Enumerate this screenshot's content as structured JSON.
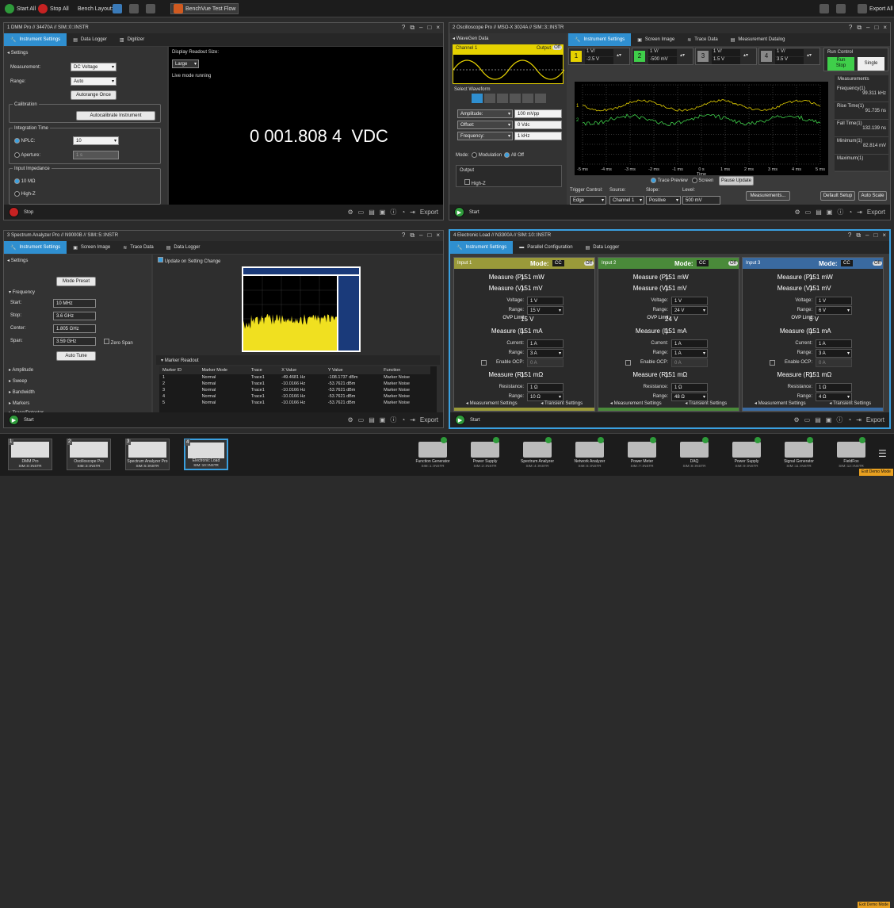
{
  "toolbar": {
    "start_all": "Start All",
    "stop_all": "Stop All",
    "bench_layout": "Bench Layout:",
    "test_flow": "BenchVue Test Flow",
    "export_all": "Export All"
  },
  "dmm": {
    "title": "1 DMM Pro // 34470A // SIM::0::INSTR",
    "tabs": [
      "Instrument Settings",
      "Data Logger",
      "Digitizer"
    ],
    "settings_header": "Settings",
    "measurement_label": "Measurement:",
    "measurement_value": "DC Voltage",
    "range_label": "Range:",
    "range_value": "Auto",
    "autorange_btn": "Autorange Once",
    "calibration_label": "Calibration",
    "autocal_btn": "Autocalibrate Instrument",
    "integration_label": "Integration Time",
    "nplc_label": "NPLC:",
    "nplc_value": "10",
    "aperture_label": "Aperture:",
    "aperture_value": "1 s",
    "impedance_label": "Input Impedance",
    "imp_10m": "10 MΩ",
    "imp_highz": "High-Z",
    "display_size_label": "Display Readout Size:",
    "display_size_value": "Large",
    "live_mode": "Live mode running",
    "readout": "0 001.808 4  VDC",
    "stop": "Stop",
    "export": "Export"
  },
  "scope": {
    "title": "2 Oscilloscope Pro // MSO-X 3024A // SIM::3::INSTR",
    "wavegen_header": "WaveGen Data",
    "tabs": [
      "Instrument Settings",
      "Screen Image",
      "Trace Data",
      "Measurement Datalog"
    ],
    "channel1": "Channel 1",
    "output": "Output",
    "off": "Off",
    "select_waveform": "Select Waveform",
    "amplitude_label": "Amplitude:",
    "amplitude_value": "100 mVpp",
    "offset_label": "Offset:",
    "offset_value": "0 Vdc",
    "frequency_label": "Frequency:",
    "frequency_value": "1 kHz",
    "mode_label": "Mode:",
    "modulation": "Modulation",
    "all_off": "All Off",
    "output_label": "Output",
    "highz": "High-Z",
    "ch": [
      {
        "num": "1",
        "scale": "1 V/",
        "offset": "-2.5 V",
        "color": "#e6d200"
      },
      {
        "num": "2",
        "scale": "1 V/",
        "offset": "-500 mV",
        "color": "#3fcf4a"
      },
      {
        "num": "3",
        "scale": "1 V/",
        "offset": "1.5 V",
        "color": "#888888"
      },
      {
        "num": "4",
        "scale": "1 V/",
        "offset": "3.5 V",
        "color": "#888888"
      }
    ],
    "run_control": "Run Control",
    "run_stop": "Run\nStop",
    "single": "Single",
    "measurements_header": "Measurements",
    "measurements": [
      {
        "name": "Frequency(1)",
        "value": "99.311 kHz"
      },
      {
        "name": "Rise Time(1)",
        "value": "91.735 ns"
      },
      {
        "name": "Fall Time(1)",
        "value": "132.139 ns"
      },
      {
        "name": "Minimum(1)",
        "value": "82.814 mV"
      },
      {
        "name": "Maximum(1)",
        "value": ""
      }
    ],
    "x_ticks": [
      "-5 ms",
      "-4 ms",
      "-3 ms",
      "-2 ms",
      "-1 ms",
      "0 s",
      "1 ms",
      "2 ms",
      "3 ms",
      "4 ms",
      "5 ms"
    ],
    "time_label": "Time",
    "trace_preview": "Trace Preview",
    "screen": "Screen",
    "pause_update": "Pause Update",
    "trigger_control_label": "Trigger Control:",
    "trigger_control_value": "Edge",
    "source_label": "Source:",
    "source_value": "Channel 1",
    "slope_label": "Slope:",
    "slope_value": "Positive",
    "level_label": "Level:",
    "level_value": "500 mV",
    "measurements_btn": "Measurements...",
    "default_setup": "Default Setup",
    "auto_scale": "Auto Scale",
    "start": "Start",
    "export": "Export"
  },
  "spec": {
    "title": "3 Spectrum Analyzer Pro // N9000B // SIM::5::INSTR",
    "tabs": [
      "Instrument Settings",
      "Screen Image",
      "Trace Data",
      "Data Logger"
    ],
    "settings_header": "Settings",
    "update_label": "Update on Setting Change",
    "frequency_header": "Frequency",
    "mode_preset": "Mode Preset",
    "start_label": "Start:",
    "start_value": "10 MHz",
    "stop_label": "Stop:",
    "stop_value": "3.6 GHz",
    "center_label": "Center:",
    "center_value": "1.805 GHz",
    "span_label": "Span:",
    "span_value": "3.59 GHz",
    "zero_span": "Zero Span",
    "auto_tune": "Auto Tune",
    "sections": [
      "Amplitude",
      "Sweep",
      "Bandwidth",
      "Markers",
      "Trace/Detector"
    ],
    "marker_readout": "Marker Readout",
    "marker_cols": [
      "Marker ID",
      "Marker Mode",
      "Trace",
      "X Value",
      "Y Value",
      "Function"
    ],
    "markers": [
      [
        "1",
        "Normal",
        "Trace1",
        "-49.4681 Hz",
        "-108.1737 dBm",
        "Marker Noise"
      ],
      [
        "2",
        "Normal",
        "Trace1",
        "-10.0166 Hz",
        "-53.7621 dBm",
        "Marker Noise"
      ],
      [
        "3",
        "Normal",
        "Trace1",
        "-10.0166 Hz",
        "-53.7621 dBm",
        "Marker Noise"
      ],
      [
        "4",
        "Normal",
        "Trace1",
        "-10.0166 Hz",
        "-53.7621 dBm",
        "Marker Noise"
      ],
      [
        "5",
        "Normal",
        "Trace1",
        "-10.0166 Hz",
        "-53.7621 dBm",
        "Marker Noise"
      ]
    ],
    "start": "Start",
    "export": "Export"
  },
  "load": {
    "title": "4 Electronic Load // N3300A // SIM::10::INSTR",
    "tabs": [
      "Instrument Settings",
      "Parallel Configuration",
      "Data Logger"
    ],
    "inputs": [
      {
        "name": "Input 1",
        "mode_label": "Mode:",
        "mode": "CC",
        "off": "Off",
        "color": "#9a9a3a",
        "power": "151 mW",
        "voltage": "151 mV",
        "voltage_set": "1 V",
        "v_range": "15 V",
        "ovp": "15 V",
        "current": "151 mA",
        "current_set": "1 A",
        "i_range": "3 A",
        "ocp": "0 A",
        "resistance": "151 mΩ",
        "res_set": "1 Ω",
        "r_range": "10 Ω"
      },
      {
        "name": "Input 2",
        "mode_label": "Mode:",
        "mode": "CC",
        "off": "Off",
        "color": "#4a8a3a",
        "power": "151 mW",
        "voltage": "151 mV",
        "voltage_set": "1 V",
        "v_range": "24 V",
        "ovp": "24 V",
        "current": "151 mA",
        "current_set": "1 A",
        "i_range": "1 A",
        "ocp": "0 A",
        "resistance": "151 mΩ",
        "res_set": "1 Ω",
        "r_range": "48 Ω"
      },
      {
        "name": "Input 3",
        "mode_label": "Mode:",
        "mode": "CC",
        "off": "Off",
        "color": "#3a6aa0",
        "power": "151 mW",
        "voltage": "151 mV",
        "voltage_set": "1 V",
        "v_range": "6 V",
        "ovp": "6 V",
        "current": "151 mA",
        "current_set": "1 A",
        "i_range": "3 A",
        "ocp": "0 A",
        "resistance": "151 mΩ",
        "res_set": "1 Ω",
        "r_range": "4 Ω"
      }
    ],
    "labels": {
      "power": "Measure (P):",
      "voltage": "Measure (V):",
      "voltage_set": "Voltage:",
      "range": "Range:",
      "ovp": "OVP Limit:",
      "current": "Measure (I):",
      "current_set": "Current:",
      "enable_ocp": "Enable OCP:",
      "resistance": "Measure (R):",
      "res_set": "Resistance:",
      "meas_settings": "Measurement Settings",
      "trans_settings": "Transient Settings"
    },
    "start": "Start",
    "export": "Export"
  },
  "dock": {
    "thumbs": [
      {
        "num": "1",
        "name": "DMM Pro",
        "addr": "SIM::0::INSTR"
      },
      {
        "num": "2",
        "name": "Oscilloscope Pro",
        "addr": "SIM::3::INSTR"
      },
      {
        "num": "3",
        "name": "Spectrum Analyzer Pro",
        "addr": "SIM::5::INSTR"
      },
      {
        "num": "4",
        "name": "Electronic Load",
        "addr": "SIM::10::INSTR"
      }
    ],
    "instruments": [
      {
        "name": "Function Generator",
        "addr": "SIM::1::INSTR"
      },
      {
        "name": "Power Supply",
        "addr": "SIM::2::INSTR"
      },
      {
        "name": "Spectrum Analyzer",
        "addr": "SIM::4::INSTR"
      },
      {
        "name": "Network Analyzer",
        "addr": "SIM::6::INSTR"
      },
      {
        "name": "Power Meter",
        "addr": "SIM::7::INSTR"
      },
      {
        "name": "DAQ",
        "addr": "SIM::8::INSTR"
      },
      {
        "name": "Power Supply",
        "addr": "SIM::9::INSTR"
      },
      {
        "name": "Signal Generator",
        "addr": "SIM::11::INSTR"
      },
      {
        "name": "FieldFox",
        "addr": "SIM::12::INSTR"
      }
    ],
    "exit_demo": "Exit Demo Mode"
  }
}
